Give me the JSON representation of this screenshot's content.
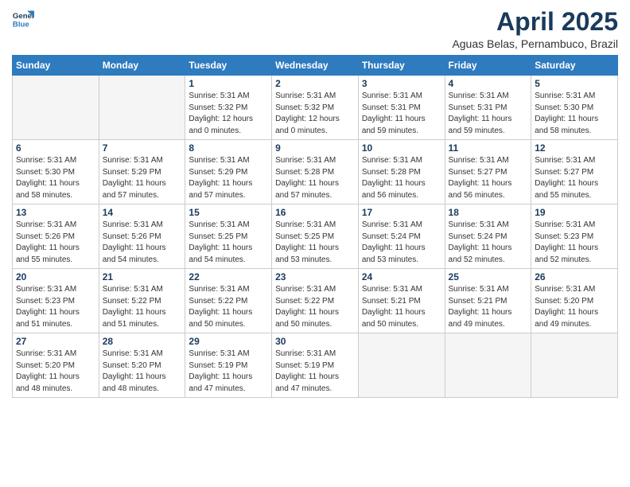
{
  "header": {
    "logo_line1": "General",
    "logo_line2": "Blue",
    "month_title": "April 2025",
    "location": "Aguas Belas, Pernambuco, Brazil"
  },
  "weekdays": [
    "Sunday",
    "Monday",
    "Tuesday",
    "Wednesday",
    "Thursday",
    "Friday",
    "Saturday"
  ],
  "weeks": [
    [
      {
        "day": "",
        "detail": ""
      },
      {
        "day": "",
        "detail": ""
      },
      {
        "day": "1",
        "detail": "Sunrise: 5:31 AM\nSunset: 5:32 PM\nDaylight: 12 hours\nand 0 minutes."
      },
      {
        "day": "2",
        "detail": "Sunrise: 5:31 AM\nSunset: 5:32 PM\nDaylight: 12 hours\nand 0 minutes."
      },
      {
        "day": "3",
        "detail": "Sunrise: 5:31 AM\nSunset: 5:31 PM\nDaylight: 11 hours\nand 59 minutes."
      },
      {
        "day": "4",
        "detail": "Sunrise: 5:31 AM\nSunset: 5:31 PM\nDaylight: 11 hours\nand 59 minutes."
      },
      {
        "day": "5",
        "detail": "Sunrise: 5:31 AM\nSunset: 5:30 PM\nDaylight: 11 hours\nand 58 minutes."
      }
    ],
    [
      {
        "day": "6",
        "detail": "Sunrise: 5:31 AM\nSunset: 5:30 PM\nDaylight: 11 hours\nand 58 minutes."
      },
      {
        "day": "7",
        "detail": "Sunrise: 5:31 AM\nSunset: 5:29 PM\nDaylight: 11 hours\nand 57 minutes."
      },
      {
        "day": "8",
        "detail": "Sunrise: 5:31 AM\nSunset: 5:29 PM\nDaylight: 11 hours\nand 57 minutes."
      },
      {
        "day": "9",
        "detail": "Sunrise: 5:31 AM\nSunset: 5:28 PM\nDaylight: 11 hours\nand 57 minutes."
      },
      {
        "day": "10",
        "detail": "Sunrise: 5:31 AM\nSunset: 5:28 PM\nDaylight: 11 hours\nand 56 minutes."
      },
      {
        "day": "11",
        "detail": "Sunrise: 5:31 AM\nSunset: 5:27 PM\nDaylight: 11 hours\nand 56 minutes."
      },
      {
        "day": "12",
        "detail": "Sunrise: 5:31 AM\nSunset: 5:27 PM\nDaylight: 11 hours\nand 55 minutes."
      }
    ],
    [
      {
        "day": "13",
        "detail": "Sunrise: 5:31 AM\nSunset: 5:26 PM\nDaylight: 11 hours\nand 55 minutes."
      },
      {
        "day": "14",
        "detail": "Sunrise: 5:31 AM\nSunset: 5:26 PM\nDaylight: 11 hours\nand 54 minutes."
      },
      {
        "day": "15",
        "detail": "Sunrise: 5:31 AM\nSunset: 5:25 PM\nDaylight: 11 hours\nand 54 minutes."
      },
      {
        "day": "16",
        "detail": "Sunrise: 5:31 AM\nSunset: 5:25 PM\nDaylight: 11 hours\nand 53 minutes."
      },
      {
        "day": "17",
        "detail": "Sunrise: 5:31 AM\nSunset: 5:24 PM\nDaylight: 11 hours\nand 53 minutes."
      },
      {
        "day": "18",
        "detail": "Sunrise: 5:31 AM\nSunset: 5:24 PM\nDaylight: 11 hours\nand 52 minutes."
      },
      {
        "day": "19",
        "detail": "Sunrise: 5:31 AM\nSunset: 5:23 PM\nDaylight: 11 hours\nand 52 minutes."
      }
    ],
    [
      {
        "day": "20",
        "detail": "Sunrise: 5:31 AM\nSunset: 5:23 PM\nDaylight: 11 hours\nand 51 minutes."
      },
      {
        "day": "21",
        "detail": "Sunrise: 5:31 AM\nSunset: 5:22 PM\nDaylight: 11 hours\nand 51 minutes."
      },
      {
        "day": "22",
        "detail": "Sunrise: 5:31 AM\nSunset: 5:22 PM\nDaylight: 11 hours\nand 50 minutes."
      },
      {
        "day": "23",
        "detail": "Sunrise: 5:31 AM\nSunset: 5:22 PM\nDaylight: 11 hours\nand 50 minutes."
      },
      {
        "day": "24",
        "detail": "Sunrise: 5:31 AM\nSunset: 5:21 PM\nDaylight: 11 hours\nand 50 minutes."
      },
      {
        "day": "25",
        "detail": "Sunrise: 5:31 AM\nSunset: 5:21 PM\nDaylight: 11 hours\nand 49 minutes."
      },
      {
        "day": "26",
        "detail": "Sunrise: 5:31 AM\nSunset: 5:20 PM\nDaylight: 11 hours\nand 49 minutes."
      }
    ],
    [
      {
        "day": "27",
        "detail": "Sunrise: 5:31 AM\nSunset: 5:20 PM\nDaylight: 11 hours\nand 48 minutes."
      },
      {
        "day": "28",
        "detail": "Sunrise: 5:31 AM\nSunset: 5:20 PM\nDaylight: 11 hours\nand 48 minutes."
      },
      {
        "day": "29",
        "detail": "Sunrise: 5:31 AM\nSunset: 5:19 PM\nDaylight: 11 hours\nand 47 minutes."
      },
      {
        "day": "30",
        "detail": "Sunrise: 5:31 AM\nSunset: 5:19 PM\nDaylight: 11 hours\nand 47 minutes."
      },
      {
        "day": "",
        "detail": ""
      },
      {
        "day": "",
        "detail": ""
      },
      {
        "day": "",
        "detail": ""
      }
    ]
  ]
}
